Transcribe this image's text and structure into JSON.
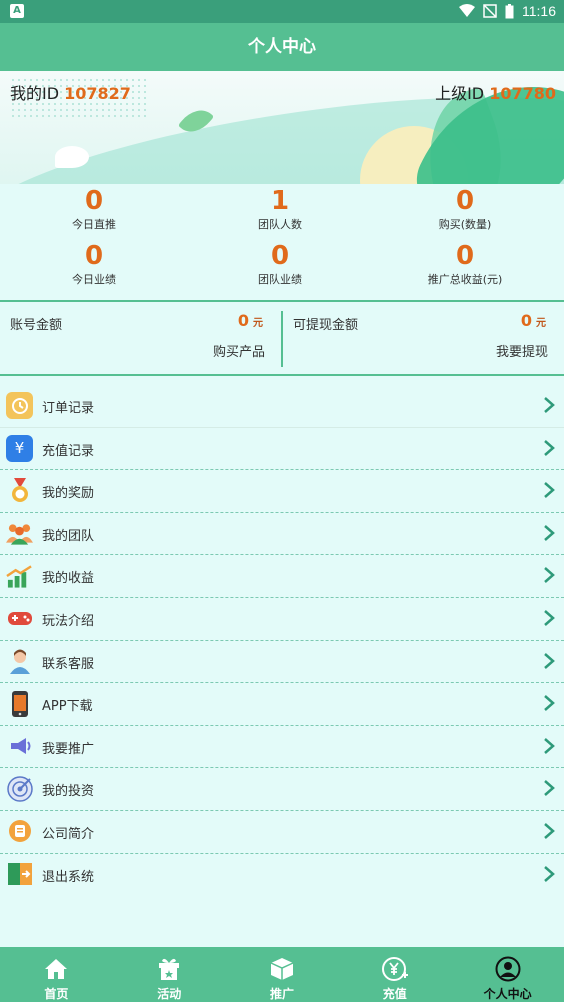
{
  "status_bar": {
    "time": "11:16"
  },
  "header": {
    "title": "个人中心"
  },
  "profile": {
    "my_id_label": "我的ID",
    "my_id": "107827",
    "upline_id_label": "上级ID",
    "upline_id": "107780"
  },
  "stats": [
    {
      "value": "0",
      "label": "今日直推"
    },
    {
      "value": "1",
      "label": "团队人数"
    },
    {
      "value": "0",
      "label": "购买(数量)"
    },
    {
      "value": "0",
      "label": "今日业绩"
    },
    {
      "value": "0",
      "label": "团队业绩"
    },
    {
      "value": "0",
      "label": "推广总收益(元)"
    }
  ],
  "accounts": {
    "balance_label": "账号金额",
    "balance_value": "0",
    "balance_unit": "元",
    "balance_action": "购买产品",
    "withdrawable_label": "可提现金额",
    "withdrawable_value": "0",
    "withdrawable_unit": "元",
    "withdrawable_action": "我要提现"
  },
  "menu": [
    {
      "label": "订单记录",
      "icon": "clock-icon",
      "color": "#f3c45b"
    },
    {
      "label": "充值记录",
      "icon": "yuan-card-icon",
      "color": "#2f7fe6"
    },
    {
      "label": "我的奖励",
      "icon": "medal-icon",
      "color": "#f2a23c"
    },
    {
      "label": "我的团队",
      "icon": "team-icon",
      "color": "#f0883a"
    },
    {
      "label": "我的收益",
      "icon": "growth-chart-icon",
      "color": "#3aa55a"
    },
    {
      "label": "玩法介绍",
      "icon": "gamepad-icon",
      "color": "#e04a3c"
    },
    {
      "label": "联系客服",
      "icon": "customer-service-icon",
      "color": "#c96b4a"
    },
    {
      "label": "APP下载",
      "icon": "phone-icon",
      "color": "#e8792a"
    },
    {
      "label": "我要推广",
      "icon": "megaphone-icon",
      "color": "#6a6fd8"
    },
    {
      "label": "我的投资",
      "icon": "target-icon",
      "color": "#5b79c8"
    },
    {
      "label": "公司简介",
      "icon": "doc-circle-icon",
      "color": "#f2a23c"
    },
    {
      "label": "退出系统",
      "icon": "exit-door-icon",
      "color": "#2e9a59"
    }
  ],
  "tabs": [
    {
      "label": "首页",
      "icon": "home-icon"
    },
    {
      "label": "活动",
      "icon": "gift-icon"
    },
    {
      "label": "推广",
      "icon": "box-icon"
    },
    {
      "label": "充值",
      "icon": "yuan-plus-icon"
    },
    {
      "label": "个人中心",
      "icon": "user-circle-icon",
      "active": true
    }
  ]
}
